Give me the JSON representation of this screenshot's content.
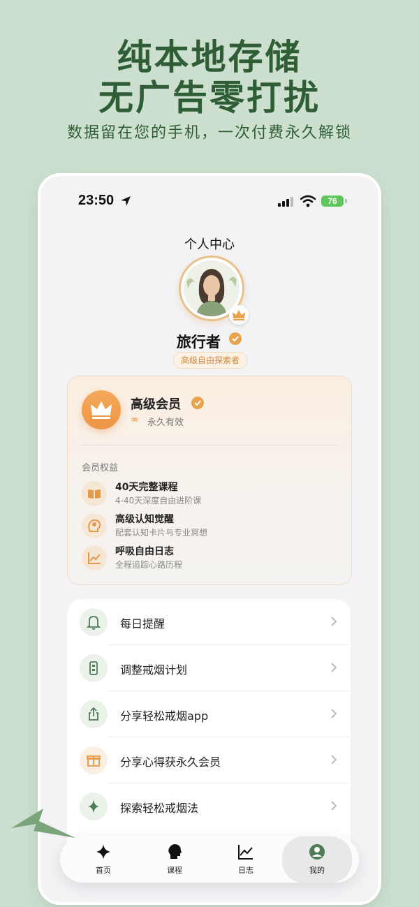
{
  "promo": {
    "headline_line1": "纯本地存储",
    "headline_line2": "无广告零打扰",
    "subtitle": "数据留在您的手机，一次付费永久解锁"
  },
  "status_bar": {
    "time": "23:50",
    "battery": "76"
  },
  "page_title": "个人中心",
  "profile": {
    "name": "旅行者",
    "level_tag": "高级自由探索者"
  },
  "membership": {
    "title": "高级会员",
    "validity": "永久有效",
    "benefits_header": "会员权益",
    "benefits": [
      {
        "title": "40天完整课程",
        "desc": "4-40天深度自由进阶课",
        "icon": "book-icon"
      },
      {
        "title": "高级认知觉醒",
        "desc": "配套认知卡片与专业冥想",
        "icon": "brain-icon"
      },
      {
        "title": "呼吸自由日志",
        "desc": "全程追踪心路历程",
        "icon": "chart-icon"
      }
    ]
  },
  "menu": [
    {
      "label": "每日提醒",
      "icon": "bell-icon"
    },
    {
      "label": "调整戒烟计划",
      "icon": "plan-icon"
    },
    {
      "label": "分享轻松戒烟app",
      "icon": "share-icon"
    },
    {
      "label": "分享心得获永久会员",
      "icon": "gift-icon"
    },
    {
      "label": "探索轻松戒烟法",
      "icon": "sparkle-icon"
    }
  ],
  "tabbar": [
    {
      "label": "首页",
      "icon": "sparkle-icon"
    },
    {
      "label": "课程",
      "icon": "head-icon"
    },
    {
      "label": "日志",
      "icon": "chart-icon"
    },
    {
      "label": "我的",
      "icon": "user-icon"
    }
  ],
  "colors": {
    "brand_green": "#2f5e36",
    "accent_orange": "#ec9546",
    "background": "#cde0cf"
  }
}
